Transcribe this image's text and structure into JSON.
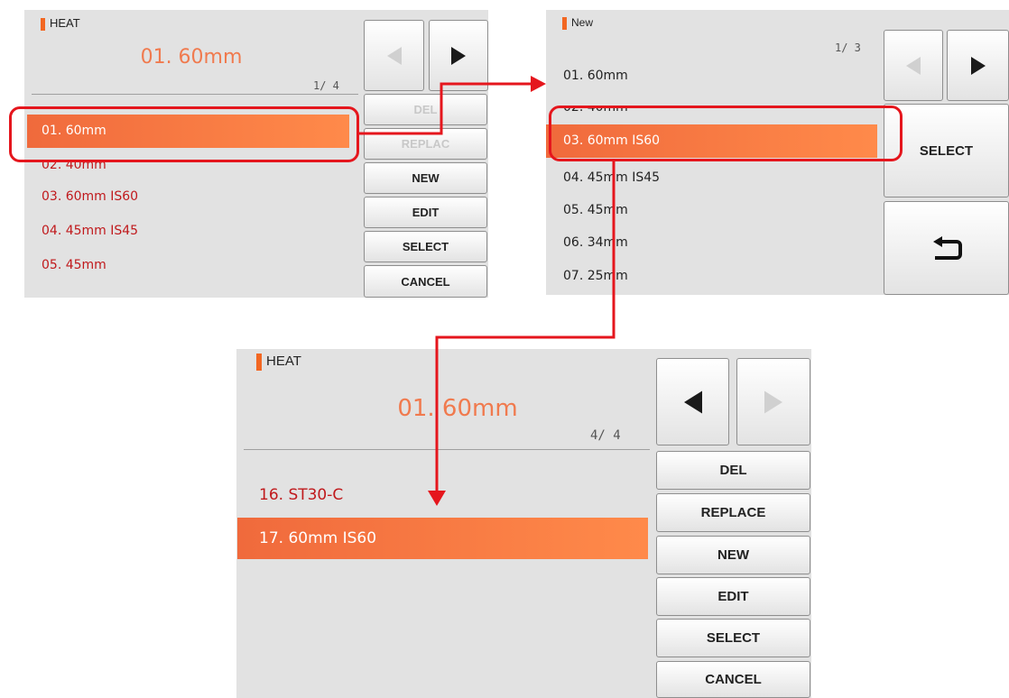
{
  "screen1": {
    "mode": "HEAT",
    "current_value": "01. 60mm",
    "page_indicator": "1/ 4",
    "items": [
      "01. 60mm",
      "02. 40mm",
      "03. 60mm IS60",
      "04. 45mm IS45",
      "05. 45mm"
    ],
    "selected_item": "01. 60mm",
    "buttons": {
      "del": "DEL",
      "replace": "REPLAC",
      "new": "NEW",
      "edit": "EDIT",
      "select": "SELECT",
      "cancel": "CANCEL"
    }
  },
  "screen2": {
    "mode": "New",
    "page_indicator": "1/ 3",
    "items": [
      "01. 60mm",
      "02. 40mm",
      "03. 60mm IS60",
      "04. 45mm IS45",
      "05. 45mm",
      "06. 34mm",
      "07. 25mm"
    ],
    "selected_item": "03. 60mm IS60",
    "buttons": {
      "select": "SELECT"
    }
  },
  "screen3": {
    "mode": "HEAT",
    "current_value": "01. 60mm",
    "page_indicator": "4/ 4",
    "items": [
      "16. ST30-C",
      "17. 60mm IS60"
    ],
    "selected_item": "17. 60mm IS60",
    "buttons": {
      "del": "DEL",
      "replace": "REPLACE",
      "new": "NEW",
      "edit": "EDIT",
      "select": "SELECT",
      "cancel": "CANCEL"
    }
  },
  "colors": {
    "accent": "#f26722",
    "highlight": "#f06a3c",
    "list_text": "#c0191c",
    "annotation": "#e5161d"
  },
  "icons": [
    "arrow-left-icon",
    "arrow-right-icon",
    "return-icon"
  ]
}
